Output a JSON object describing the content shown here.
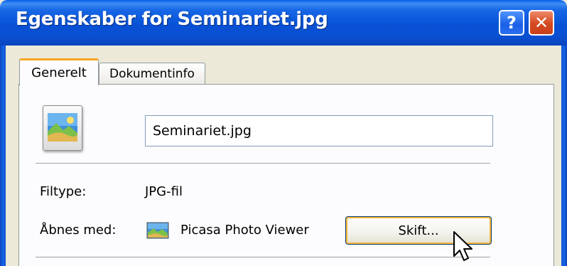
{
  "window": {
    "title": "Egenskaber for Seminariet.jpg",
    "help_label": "?",
    "close_label": "✕"
  },
  "tabs": [
    {
      "label": "Generelt",
      "active": true
    },
    {
      "label": "Dokumentinfo",
      "active": false
    }
  ],
  "file": {
    "icon": "image-file-icon",
    "name_value": "Seminariet.jpg"
  },
  "properties": {
    "filetype_label": "Filtype:",
    "filetype_value": "JPG-fil",
    "opens_with_label": "Åbnes med:",
    "opens_with_app": "Picasa Photo Viewer",
    "change_button_label": "Skift..."
  },
  "colors": {
    "titlebar": "#0a4fd1",
    "tab_highlight": "#f5a623",
    "button_focus": "#f8b53a",
    "close_button": "#d5481f"
  }
}
